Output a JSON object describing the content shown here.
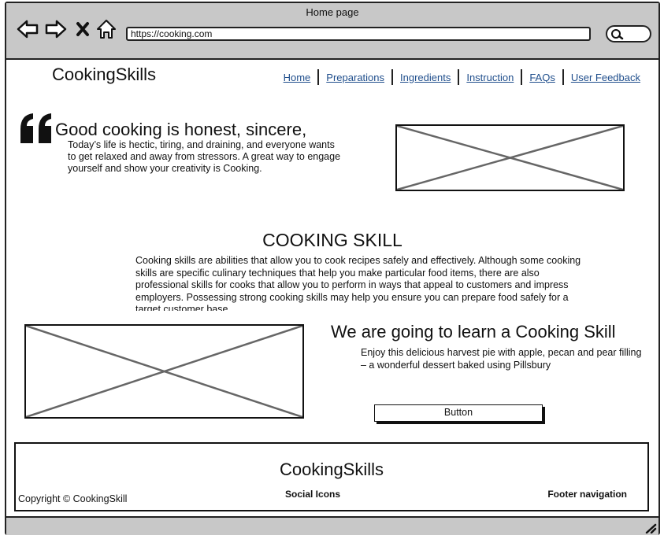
{
  "window": {
    "title": "Home page"
  },
  "browser": {
    "url": "https://cooking.com",
    "icons": [
      "back-arrow-icon",
      "forward-arrow-icon",
      "close-x-icon",
      "home-icon",
      "search-icon"
    ]
  },
  "header": {
    "brand": "CookingSkills",
    "nav": [
      "Home",
      "Preparations",
      "Ingredients",
      "Instruction",
      "FAQs",
      "User Feedback"
    ]
  },
  "hero": {
    "title": "Good cooking is honest, sincere,",
    "text": "Today’s life is hectic, tiring, and draining, and everyone wants to get relaxed and away from stressors. A great way to engage yourself and show your creativity is Cooking."
  },
  "skill": {
    "title": "COOKING SKILL",
    "text": "Cooking skills are abilities that allow you to cook recipes safely and effectively. Although some cooking skills are specific culinary techniques that help you make particular food items, there are also professional skills for cooks that allow you to perform in ways that appeal to customers and impress employers. Possessing strong cooking skills may help you ensure you can prepare food safely for a target customer base."
  },
  "learn": {
    "title": "We are going to learn a Cooking Skill",
    "text": "Enjoy this delicious harvest pie with apple, pecan and pear filling – a wonderful dessert baked using Pillsbury",
    "button": "Button"
  },
  "footer": {
    "brand": "CookingSkills",
    "copyright": "Copyright © CookingSkill",
    "social": "Social Icons",
    "navigation": "Footer navigation"
  },
  "colors": {
    "chrome": "#c8c8c8",
    "link": "#1f4e8c",
    "placeholder_cross": "#666666"
  }
}
